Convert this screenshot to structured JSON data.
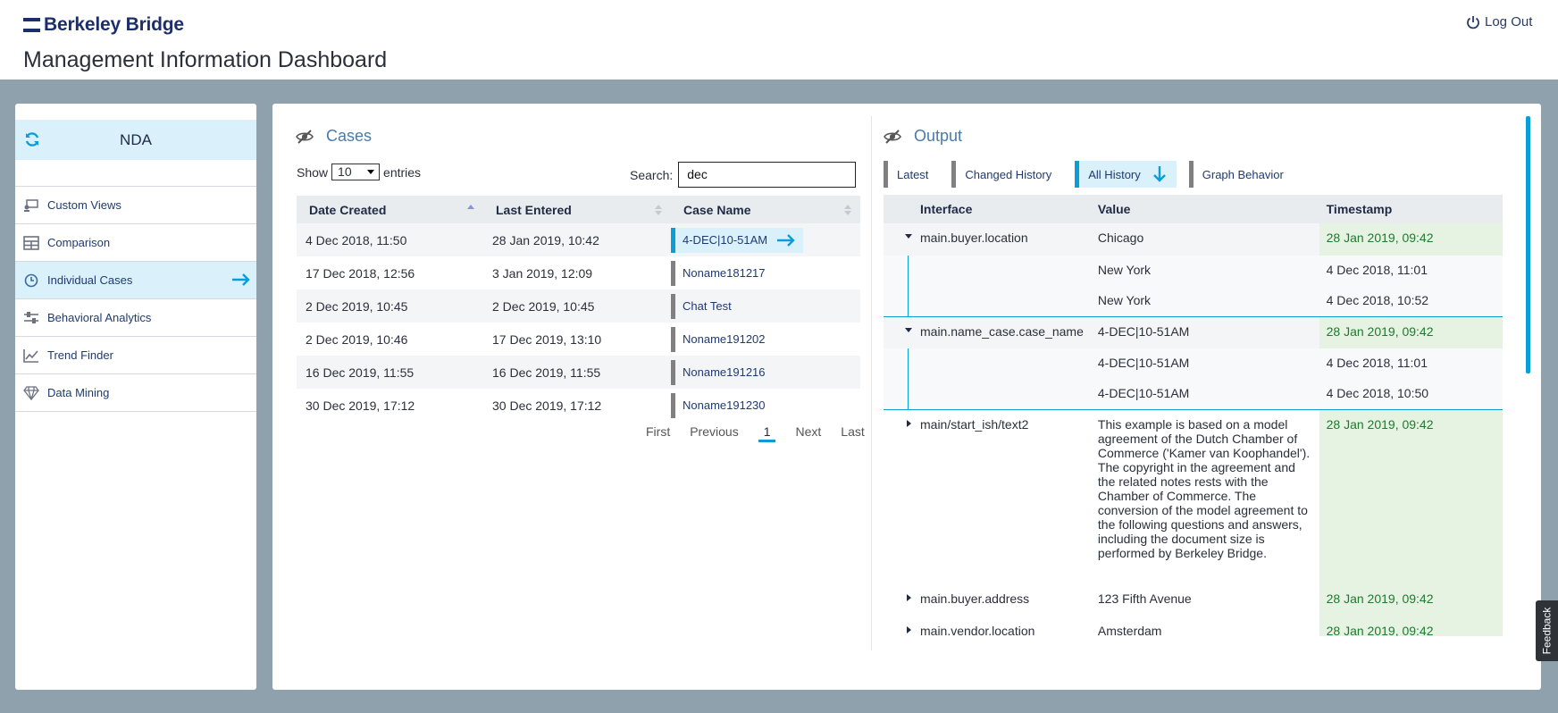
{
  "header": {
    "logo_text": "Berkeley Bridge",
    "page_title": "Management Information Dashboard",
    "logout_label": "Log Out"
  },
  "sidebar": {
    "project": "NDA",
    "items": [
      {
        "label": "Custom Views",
        "icon": "custom-views-icon"
      },
      {
        "label": "Comparison",
        "icon": "table-grid-icon"
      },
      {
        "label": "Individual Cases",
        "icon": "clock-icon",
        "active": true
      },
      {
        "label": "Behavioral Analytics",
        "icon": "sliders-icon"
      },
      {
        "label": "Trend Finder",
        "icon": "trend-chart-icon"
      },
      {
        "label": "Data Mining",
        "icon": "diamond-icon"
      }
    ]
  },
  "cases": {
    "title": "Cases",
    "show_label": "Show",
    "entries_value": "10",
    "entries_label": "entries",
    "search_label": "Search:",
    "search_value": "dec",
    "columns": [
      "Date Created",
      "Last Entered",
      "Case Name"
    ],
    "rows": [
      {
        "created": "4 Dec 2018, 11:50",
        "entered": "28 Jan 2019, 10:42",
        "name": "4-DEC|10-51AM",
        "active": true
      },
      {
        "created": "17 Dec 2018, 12:56",
        "entered": "3 Jan 2019, 12:09",
        "name": "Noname181217"
      },
      {
        "created": "2 Dec 2019, 10:45",
        "entered": "2 Dec 2019, 10:45",
        "name": "Chat Test"
      },
      {
        "created": "2 Dec 2019, 10:46",
        "entered": "17 Dec 2019, 13:10",
        "name": "Noname191202"
      },
      {
        "created": "16 Dec 2019, 11:55",
        "entered": "16 Dec 2019, 11:55",
        "name": "Noname191216"
      },
      {
        "created": "30 Dec 2019, 17:12",
        "entered": "30 Dec 2019, 17:12",
        "name": "Noname191230"
      }
    ],
    "pager": {
      "first": "First",
      "previous": "Previous",
      "current": "1",
      "next": "Next",
      "last": "Last"
    }
  },
  "output": {
    "title": "Output",
    "tabs": [
      "Latest",
      "Changed History",
      "All History",
      "Graph Behavior"
    ],
    "active_tab": "All History",
    "columns": [
      "Interface",
      "Value",
      "Timestamp"
    ],
    "rows": [
      {
        "interface": "main.buyer.location",
        "value": "Chicago",
        "timestamp": "28 Jan 2019, 09:42"
      },
      {
        "value": "New York",
        "timestamp": "4 Dec 2018, 11:01"
      },
      {
        "value": "New York",
        "timestamp": "4 Dec 2018, 10:52"
      },
      {
        "interface": "main.name_case.case_name",
        "value": "4-DEC|10-51AM",
        "timestamp": "28 Jan 2019, 09:42"
      },
      {
        "value": "4-DEC|10-51AM",
        "timestamp": "4 Dec 2018, 11:01"
      },
      {
        "value": "4-DEC|10-51AM",
        "timestamp": "4 Dec 2018, 10:50"
      },
      {
        "interface": "main/start_ish/text2",
        "value": "This example is based on a model agreement of the Dutch Chamber of Commerce ('Kamer van Koophandel'). The copyright in the agreement and the related notes rests with the Chamber of Commerce. The conversion of the model agreement to the following questions and answers, including the document size is performed by Berkeley Bridge.",
        "timestamp": "28 Jan 2019, 09:42"
      },
      {
        "interface": "main.buyer.address",
        "value": "123 Fifth Avenue",
        "timestamp": "28 Jan 2019, 09:42"
      },
      {
        "interface": "main.vendor.location",
        "value": "Amsterdam",
        "timestamp": "28 Jan 2019, 09:42"
      }
    ]
  },
  "feedback_label": "Feedback",
  "colors": {
    "accent": "#0a9ed8",
    "active_bg": "#daf0fa",
    "band": "#8ea1ad",
    "timestamp_green": "#1e7a2e"
  }
}
